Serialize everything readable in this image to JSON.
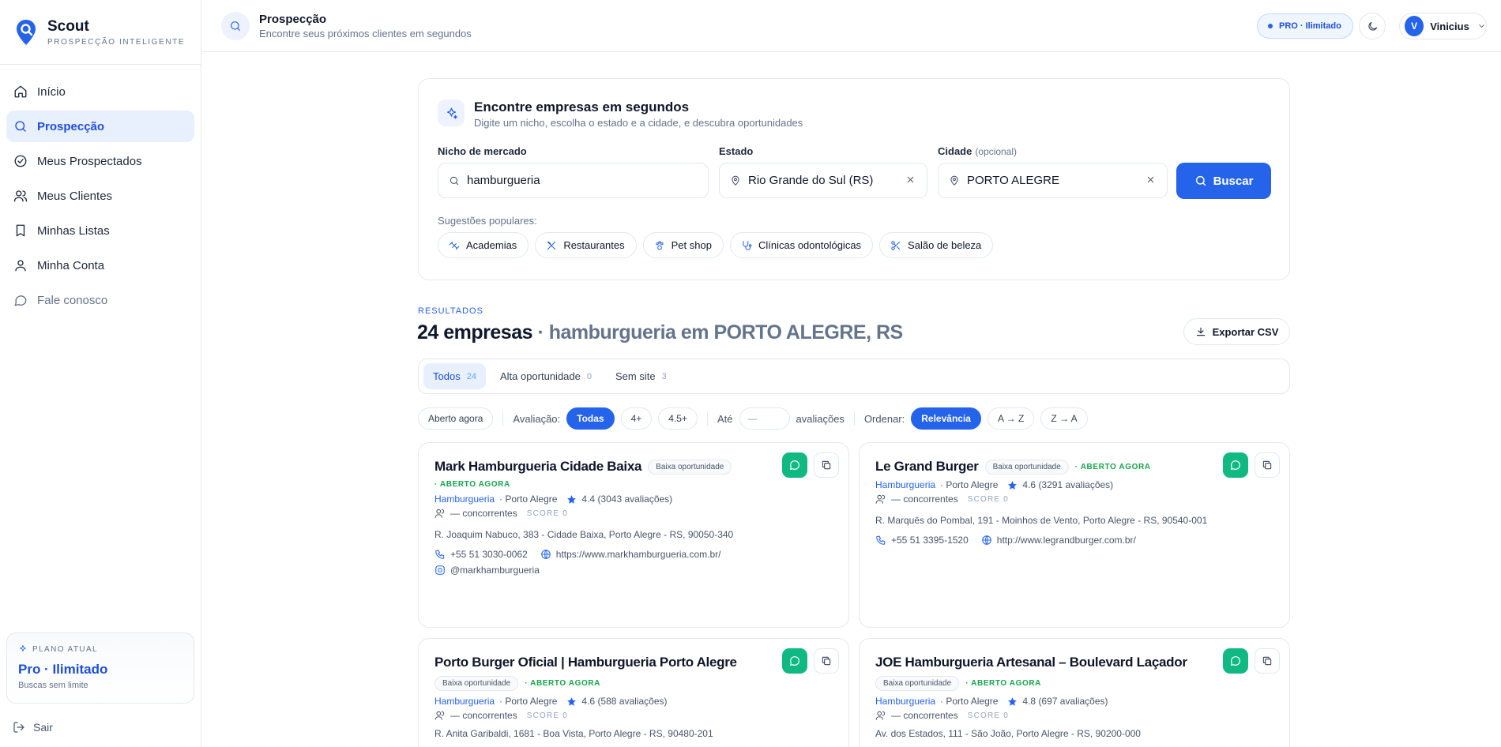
{
  "brand": {
    "name": "Scout",
    "tagline": "PROSPECÇÃO INTELIGENTE",
    "accent": "#2563eb"
  },
  "sidebar": {
    "items": [
      {
        "label": "Início",
        "icon": "home-icon"
      },
      {
        "label": "Prospecção",
        "icon": "search-icon",
        "active": true
      },
      {
        "label": "Meus Prospectados",
        "icon": "check-circle-icon"
      },
      {
        "label": "Meus Clientes",
        "icon": "users-icon"
      },
      {
        "label": "Minhas Listas",
        "icon": "bookmark-icon"
      },
      {
        "label": "Minha Conta",
        "icon": "user-icon"
      },
      {
        "label": "Fale conosco",
        "icon": "chat-icon"
      }
    ],
    "plan": {
      "label": "PLANO ATUAL",
      "name": "Pro · Ilimitado",
      "sub": "Buscas sem limite"
    },
    "logout": "Sair"
  },
  "header": {
    "title": "Prospecção",
    "subtitle": "Encontre seus próximos clientes em segundos",
    "plan_badge": "PRO · Ilimitado",
    "user_initial": "V",
    "user_name": "Vinicius"
  },
  "search": {
    "title": "Encontre empresas em segundos",
    "subtitle": "Digite um nicho, escolha o estado e a cidade, e descubra oportunidades",
    "niche_label": "Nicho de mercado",
    "niche_value": "hamburgueria",
    "state_label": "Estado",
    "state_value": "Rio Grande do Sul (RS)",
    "city_label": "Cidade",
    "city_optional": "(opcional)",
    "city_value": "PORTO ALEGRE",
    "button": "Buscar",
    "suggestions_label": "Sugestões populares:",
    "suggestions": [
      {
        "label": "Academias",
        "icon": "dumbbell-icon"
      },
      {
        "label": "Restaurantes",
        "icon": "utensils-icon"
      },
      {
        "label": "Pet shop",
        "icon": "paw-icon"
      },
      {
        "label": "Clínicas odontológicas",
        "icon": "stethoscope-icon"
      },
      {
        "label": "Salão de beleza",
        "icon": "scissors-icon"
      }
    ]
  },
  "results": {
    "kicker": "RESULTADOS",
    "count": "24 empresas",
    "query": "· hamburgueria em PORTO ALEGRE, RS",
    "export": "Exportar CSV",
    "tabs": [
      {
        "label": "Todos",
        "count": "24",
        "active": true
      },
      {
        "label": "Alta oportunidade",
        "count": "0"
      },
      {
        "label": "Sem site",
        "count": "3"
      }
    ],
    "filters": {
      "open_now": "Aberto agora",
      "rating_label": "Avaliação:",
      "rating_options": [
        "Todas",
        "4+",
        "4.5+"
      ],
      "until_label": "Até",
      "until_placeholder": "—",
      "reviews_label": "avaliações",
      "order_label": "Ordenar:",
      "order_options": [
        "Relevância",
        "A → Z",
        "Z → A"
      ]
    },
    "cards": [
      {
        "name": "Mark Hamburgueria Cidade Baixa",
        "badge": "Baixa oportunidade",
        "status": "· ABERTO AGORA",
        "category": "Hamburgueria",
        "city": "· Porto Alegre",
        "rating": "4.4 (3043 avaliações)",
        "competitors": "— concorrentes",
        "score": "SCORE 0",
        "address": "R. Joaquim Nabuco, 383 - Cidade Baixa, Porto Alegre - RS, 90050-340",
        "phone": "+55 51 3030-0062",
        "website": "https://www.markhamburgueria.com.br/",
        "instagram": "@markhamburgueria"
      },
      {
        "name": "Le Grand Burger",
        "badge": "Baixa oportunidade",
        "status": "· ABERTO AGORA",
        "category": "Hamburgueria",
        "city": "· Porto Alegre",
        "rating": "4.6 (3291 avaliações)",
        "competitors": "— concorrentes",
        "score": "SCORE 0",
        "address": "R. Marquês do Pombal, 191 - Moinhos de Vento, Porto Alegre - RS, 90540-001",
        "phone": "+55 51 3395-1520",
        "website": "http://www.legrandburger.com.br/"
      },
      {
        "name": "Porto Burger Oficial | Hamburgueria Porto Alegre",
        "badge": "Baixa oportunidade",
        "status": "· ABERTO AGORA",
        "category": "Hamburgueria",
        "city": "· Porto Alegre",
        "rating": "4.6 (588 avaliações)",
        "competitors": "— concorrentes",
        "score": "SCORE 0",
        "address": "R. Anita Garibaldi, 1681 - Boa Vista, Porto Alegre - RS, 90480-201"
      },
      {
        "name": "JOE Hamburgueria Artesanal – Boulevard Laçador",
        "badge": "Baixa oportunidade",
        "status": "· ABERTO AGORA",
        "category": "Hamburgueria",
        "city": "· Porto Alegre",
        "rating": "4.8 (697 avaliações)",
        "competitors": "— concorrentes",
        "score": "SCORE 0",
        "address": "Av. dos Estados, 111 - São João, Porto Alegre - RS, 90200-000"
      }
    ]
  }
}
